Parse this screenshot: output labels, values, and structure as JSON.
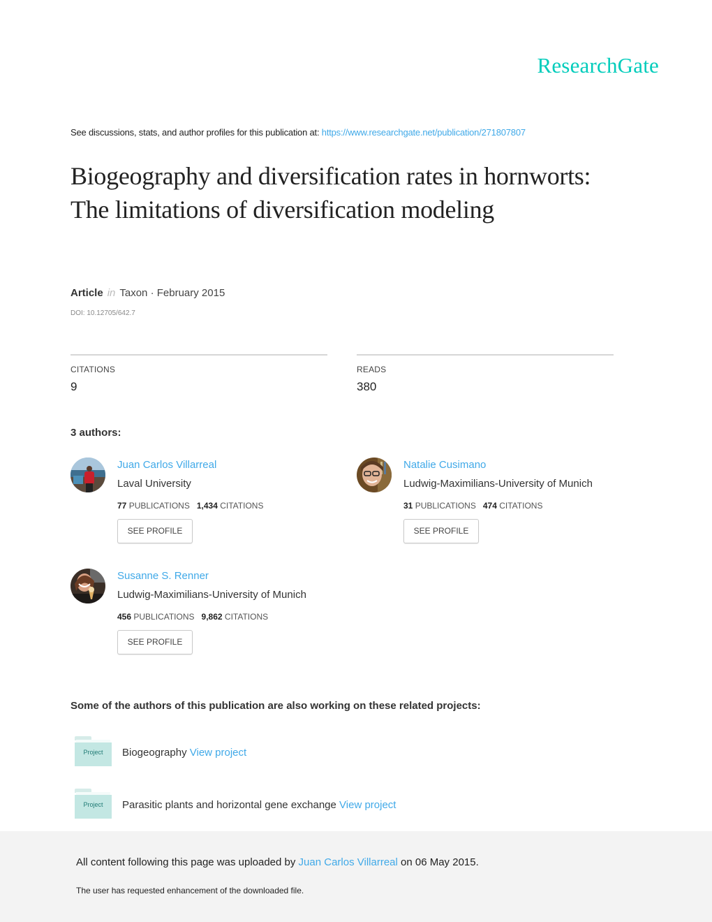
{
  "brand": {
    "logo_text": "ResearchGate",
    "color": "#00ccbb"
  },
  "header": {
    "see_text": "See discussions, stats, and author profiles for this publication at: ",
    "url": "https://www.researchgate.net/publication/271807807"
  },
  "publication": {
    "title": "Biogeography and diversification rates in hornworts: The limitations of diversification modeling",
    "type": "Article",
    "in_label": "in",
    "journal_date": "Taxon · February 2015",
    "doi": "DOI: 10.12705/642.7"
  },
  "stats": {
    "citations_label": "CITATIONS",
    "citations_value": "9",
    "reads_label": "READS",
    "reads_value": "380"
  },
  "authors_heading": "3 authors:",
  "authors": [
    {
      "name": "Juan Carlos Villarreal",
      "affiliation": "Laval University",
      "publications": "77",
      "publications_label": "PUBLICATIONS",
      "citations": "1,434",
      "citations_label": "CITATIONS",
      "button": "SEE PROFILE"
    },
    {
      "name": "Natalie Cusimano",
      "affiliation": "Ludwig-Maximilians-University of Munich",
      "publications": "31",
      "publications_label": "PUBLICATIONS",
      "citations": "474",
      "citations_label": "CITATIONS",
      "button": "SEE PROFILE"
    },
    {
      "name": "Susanne S. Renner",
      "affiliation": "Ludwig-Maximilians-University of Munich",
      "publications": "456",
      "publications_label": "PUBLICATIONS",
      "citations": "9,862",
      "citations_label": "CITATIONS",
      "button": "SEE PROFILE"
    }
  ],
  "related": {
    "heading": "Some of the authors of this publication are also working on these related projects:",
    "projects": [
      {
        "icon_label": "Project",
        "title": "Biogeography",
        "link": "View project"
      },
      {
        "icon_label": "Project",
        "title": "Parasitic plants and horizontal gene exchange",
        "link": "View project"
      }
    ]
  },
  "footer": {
    "uploaded_prefix": "All content following this page was uploaded by ",
    "uploader": "Juan Carlos Villarreal",
    "uploaded_suffix": " on 06 May 2015.",
    "note": "The user has requested enhancement of the downloaded file."
  },
  "colors": {
    "link": "#40a9e8",
    "footer_bg": "#f3f3f3",
    "folder": "#c3e7e3"
  }
}
